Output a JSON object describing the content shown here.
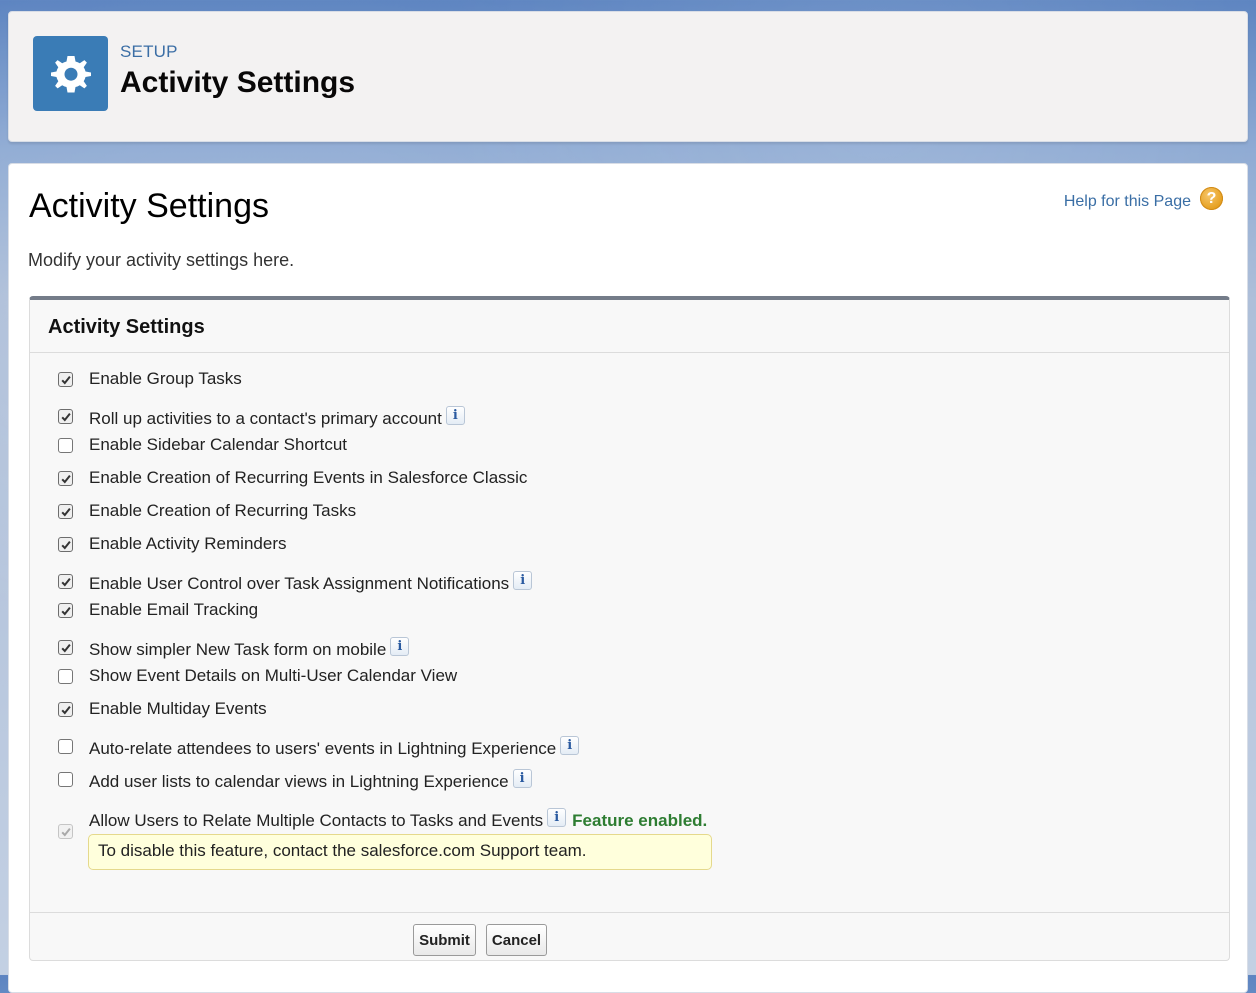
{
  "header": {
    "eyebrow": "SETUP",
    "title": "Activity Settings",
    "icon": "gear-icon"
  },
  "page": {
    "title": "Activity Settings",
    "help_link": "Help for this Page",
    "help_icon": "question-icon",
    "description": "Modify your activity settings here."
  },
  "section": {
    "title": "Activity Settings",
    "options": [
      {
        "label": "Enable Group Tasks",
        "checked": true,
        "info": false
      },
      {
        "label": "Roll up activities to a contact's primary account",
        "checked": true,
        "info": true
      },
      {
        "label": "Enable Sidebar Calendar Shortcut",
        "checked": false,
        "info": false
      },
      {
        "label": "Enable Creation of Recurring Events in Salesforce Classic",
        "checked": true,
        "info": false
      },
      {
        "label": "Enable Creation of Recurring Tasks",
        "checked": true,
        "info": false
      },
      {
        "label": "Enable Activity Reminders",
        "checked": true,
        "info": false
      },
      {
        "label": "Enable User Control over Task Assignment Notifications",
        "checked": true,
        "info": true
      },
      {
        "label": "Enable Email Tracking",
        "checked": true,
        "info": false
      },
      {
        "label": "Show simpler New Task form on mobile",
        "checked": true,
        "info": true
      },
      {
        "label": "Show Event Details on Multi-User Calendar View",
        "checked": false,
        "info": false
      },
      {
        "label": "Enable Multiday Events",
        "checked": true,
        "info": false
      },
      {
        "label": "Auto-relate attendees to users' events in Lightning Experience",
        "checked": false,
        "info": true
      },
      {
        "label": "Add user lists to calendar views in Lightning Experience",
        "checked": false,
        "info": true
      },
      {
        "label": "Allow Users to Relate Multiple Contacts to Tasks and Events",
        "checked": true,
        "info": true,
        "disabled": true
      }
    ],
    "info_glyph": "i",
    "feature_status": "Feature enabled.",
    "note": "To disable this feature, contact the salesforce.com Support team."
  },
  "buttons": {
    "submit": "Submit",
    "cancel": "Cancel"
  },
  "colors": {
    "header_icon_bg": "#3a7cb6",
    "feature_enabled": "#2e7d32",
    "link": "#3a6ea5"
  }
}
